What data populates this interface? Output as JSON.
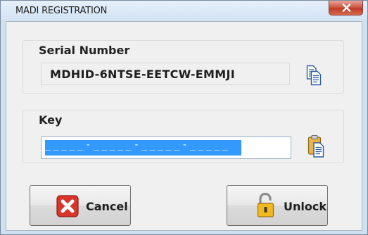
{
  "window": {
    "title": "MADI REGISTRATION",
    "close_icon": "close-x-icon"
  },
  "serial": {
    "label": "Serial Number",
    "value": "MDHID-6NTSE-EETCW-EMMJI",
    "copy_icon": "copy-icon"
  },
  "key": {
    "label": "Key",
    "value": "_____-_____-_____-_____",
    "state": "all text selected",
    "paste_icon": "paste-icon"
  },
  "buttons": {
    "cancel_label": "Cancel",
    "cancel_icon": "red-x-icon",
    "unlock_label": "Unlock",
    "unlock_icon": "padlock-open-icon"
  },
  "colors": {
    "selection": "#3399ff",
    "close_button": "#c23a26",
    "cancel_icon": "#d9352a",
    "lock_body": "#f2b820"
  }
}
